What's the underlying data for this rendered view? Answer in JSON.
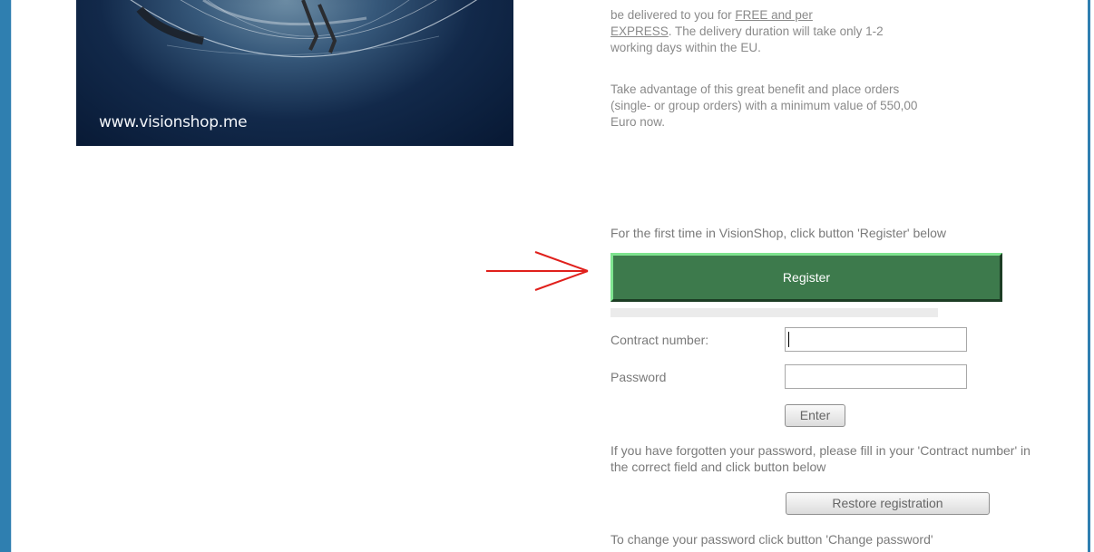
{
  "banner": {
    "url_text": "www.visionshop.me"
  },
  "intro": {
    "p1_before": "be delivered to you for ",
    "p1_link1": "FREE and per",
    "p1_link2": "EXPRESS",
    "p1_after": ". The delivery duration will take only 1-2 working days within the EU.",
    "p2": "Take advantage of this great benefit and place orders (single- or group orders) with a minimum value of 550,00 Euro now."
  },
  "register": {
    "hint": "For the first time in VisionShop, click button 'Register' below",
    "button_label": "Register"
  },
  "login": {
    "contract_label": "Contract number:",
    "contract_value": "",
    "password_label": "Password",
    "password_value": "",
    "enter_label": "Enter"
  },
  "forgot": {
    "text": "If you have forgotten your password, please fill in your 'Contract number' in the correct field and click button below",
    "restore_label": "Restore registration"
  },
  "change_password": {
    "text": "To change your password click button 'Change password'"
  },
  "colors": {
    "side_bar": "#2f7fb0",
    "register_bg": "#3d7a4c",
    "arrow": "#e0201c"
  }
}
